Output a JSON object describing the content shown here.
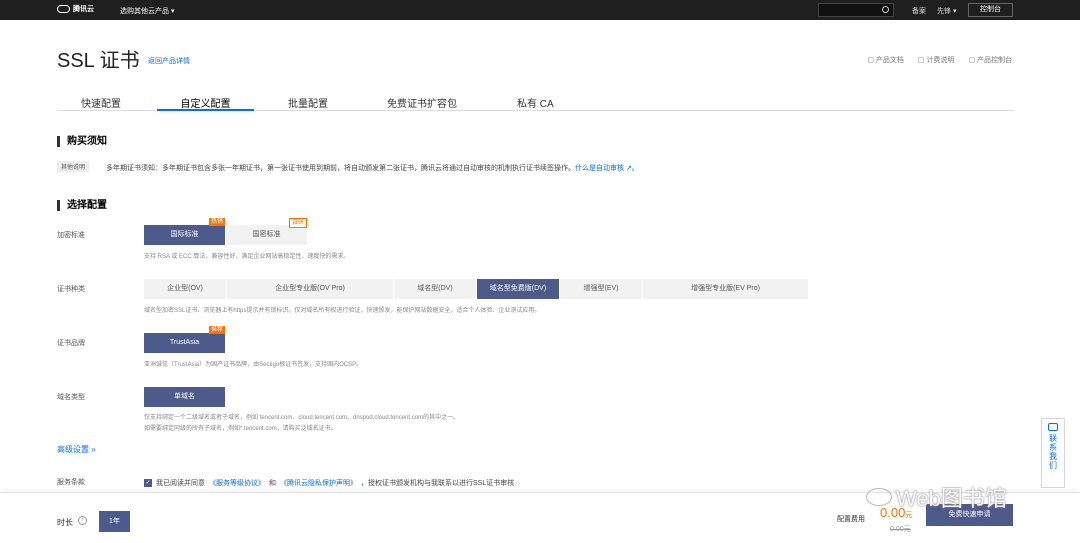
{
  "topbar": {
    "brand": "腾讯云",
    "product_menu": "选购其他云产品",
    "beian": "备案",
    "user": "先锋",
    "console": "控制台"
  },
  "header": {
    "title": "SSL 证书",
    "back_link": "返回产品详情",
    "links": [
      "产品文档",
      "计费说明",
      "产品控制台"
    ]
  },
  "tabs": [
    "快速配置",
    "自定义配置",
    "批量配置",
    "免费证书扩容包",
    "私有 CA"
  ],
  "active_tab": 1,
  "purchase_notice": {
    "title": "购买须知",
    "tag": "其他说明",
    "text": "多年期证书须知：多年期证书包含多张一年期证书，第一张证书使用到期前，将自动颁发第二张证书，腾讯云将通过自动审核的机制执行证书续签操作。",
    "link": "什么是自动审核"
  },
  "config": {
    "title": "选择配置",
    "encryption": {
      "label": "加密标准",
      "options": [
        "国际标准",
        "国密标准"
      ],
      "selected": 0,
      "badges": [
        "热销",
        "自研"
      ],
      "hint": "支持 RSA 或 ECC 算法，兼容性好，满足企业网站高稳定性、速度快的需求。"
    },
    "cert_type": {
      "label": "证书种类",
      "options": [
        "企业型(OV)",
        "企业型专业版(OV Pro)",
        "域名型(DV)",
        "域名型免费版(DV)",
        "增强型(EV)",
        "增强型专业版(EV Pro)"
      ],
      "selected": 3,
      "hint": "域名型加密SSL证书、浏览器上有https提示并有锁标识。仅对域名所有权进行验证，快速颁发，能保护网站数据安全，适合个人体验、企业测试应用。"
    },
    "brand": {
      "label": "证书品牌",
      "options": [
        "TrustAsia"
      ],
      "selected": 0,
      "badge": "推荐",
      "hint": "亚洲诚信（TrustAsia）为国产证书品牌，由Sectigo根证书签发，支持国内OCSP。"
    },
    "domain_type": {
      "label": "域名类型",
      "options": [
        "单域名"
      ],
      "selected": 0,
      "hint1": "仅支持绑定一个二级域名或者子域名，例如 tencent.com、cloud.tencent.com、dnspod.cloud.tencent.com的其中之一。",
      "hint2": "如需要绑定同级的所有子域名，例如*.tencent.com，请购买泛域名证书。"
    },
    "advanced": "高级设置",
    "terms": {
      "label": "服务条款",
      "checkbox": "✓",
      "text_a": "我已阅读并同意",
      "link1": "《服务等级协议》",
      "text_b": "和",
      "link2": "《腾讯云隐私保护声明》",
      "text_c": "，授权证书颁发机构与我联系以进行SSL证书审核"
    }
  },
  "bottom": {
    "duration_label": "时长",
    "info": "i",
    "duration": "1年",
    "fee_label": "配置费用",
    "price": "0.00",
    "unit": "元",
    "original_price": "0.00元",
    "apply": "免费快速申请"
  },
  "contact": "联系我们",
  "watermark": "Web图书馆"
}
